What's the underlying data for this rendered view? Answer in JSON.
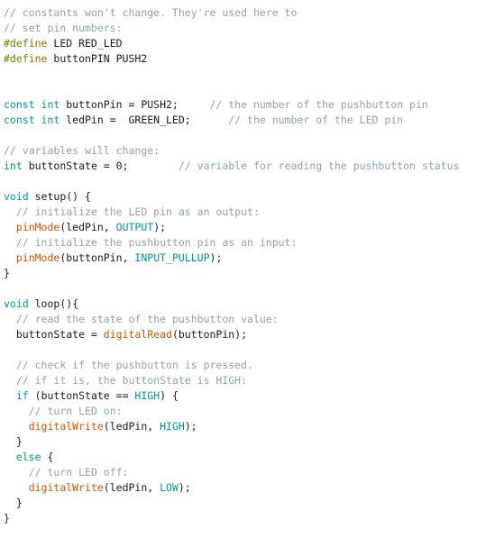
{
  "editor": {
    "language": "arduino-c",
    "background_color": "#ffffff",
    "colors": {
      "plain": "#1a1a1a",
      "comment": "#95a0ac",
      "preprocessor": "#7f7c00",
      "keyword": "#00979c",
      "constant": "#00979c",
      "function": "#d35400"
    },
    "lines": [
      {
        "id": "l1",
        "tokens": [
          {
            "t": "comment",
            "s": "// constants won't change. They're used here to"
          }
        ]
      },
      {
        "id": "l2",
        "tokens": [
          {
            "t": "comment",
            "s": "// set pin numbers:"
          }
        ]
      },
      {
        "id": "l3",
        "tokens": [
          {
            "t": "pre",
            "s": "#define"
          },
          {
            "t": "plain",
            "s": " LED RED_LED"
          }
        ]
      },
      {
        "id": "l4",
        "tokens": [
          {
            "t": "pre",
            "s": "#define"
          },
          {
            "t": "plain",
            "s": " buttonPIN PUSH2"
          }
        ]
      },
      {
        "id": "l5",
        "tokens": [
          {
            "t": "blank",
            "s": " "
          }
        ]
      },
      {
        "id": "l6",
        "tokens": [
          {
            "t": "blank",
            "s": " "
          }
        ]
      },
      {
        "id": "l7",
        "tokens": [
          {
            "t": "kw",
            "s": "const int"
          },
          {
            "t": "plain",
            "s": " buttonPin = PUSH2;     "
          },
          {
            "t": "comment",
            "s": "// the number of the pushbutton pin"
          }
        ]
      },
      {
        "id": "l8",
        "tokens": [
          {
            "t": "kw",
            "s": "const int"
          },
          {
            "t": "plain",
            "s": " ledPin =  GREEN_LED;      "
          },
          {
            "t": "comment",
            "s": "// the number of the LED pin"
          }
        ]
      },
      {
        "id": "l9",
        "tokens": [
          {
            "t": "blank",
            "s": " "
          }
        ]
      },
      {
        "id": "l10",
        "tokens": [
          {
            "t": "comment",
            "s": "// variables will change:"
          }
        ]
      },
      {
        "id": "l11",
        "tokens": [
          {
            "t": "kw",
            "s": "int"
          },
          {
            "t": "plain",
            "s": " buttonState = 0;        "
          },
          {
            "t": "comment",
            "s": "// variable for reading the pushbutton status"
          }
        ]
      },
      {
        "id": "l12",
        "tokens": [
          {
            "t": "blank",
            "s": " "
          }
        ]
      },
      {
        "id": "l13",
        "tokens": [
          {
            "t": "kw",
            "s": "void"
          },
          {
            "t": "plain",
            "s": " setup() {"
          }
        ]
      },
      {
        "id": "l14",
        "tokens": [
          {
            "t": "plain",
            "s": "  "
          },
          {
            "t": "comment",
            "s": "// initialize the LED pin as an output:"
          }
        ]
      },
      {
        "id": "l15",
        "tokens": [
          {
            "t": "plain",
            "s": "  "
          },
          {
            "t": "fn",
            "s": "pinMode"
          },
          {
            "t": "plain",
            "s": "(ledPin, "
          },
          {
            "t": "const",
            "s": "OUTPUT"
          },
          {
            "t": "plain",
            "s": ");"
          }
        ]
      },
      {
        "id": "l16",
        "tokens": [
          {
            "t": "plain",
            "s": "  "
          },
          {
            "t": "comment",
            "s": "// initialize the pushbutton pin as an input:"
          }
        ]
      },
      {
        "id": "l17",
        "tokens": [
          {
            "t": "plain",
            "s": "  "
          },
          {
            "t": "fn",
            "s": "pinMode"
          },
          {
            "t": "plain",
            "s": "(buttonPin, "
          },
          {
            "t": "const",
            "s": "INPUT_PULLUP"
          },
          {
            "t": "plain",
            "s": ");"
          }
        ]
      },
      {
        "id": "l18",
        "tokens": [
          {
            "t": "plain",
            "s": "}"
          }
        ]
      },
      {
        "id": "l19",
        "tokens": [
          {
            "t": "blank",
            "s": " "
          }
        ]
      },
      {
        "id": "l20",
        "tokens": [
          {
            "t": "kw",
            "s": "void"
          },
          {
            "t": "plain",
            "s": " loop(){"
          }
        ]
      },
      {
        "id": "l21",
        "tokens": [
          {
            "t": "plain",
            "s": "  "
          },
          {
            "t": "comment",
            "s": "// read the state of the pushbutton value:"
          }
        ]
      },
      {
        "id": "l22",
        "tokens": [
          {
            "t": "plain",
            "s": "  buttonState = "
          },
          {
            "t": "fn",
            "s": "digitalRead"
          },
          {
            "t": "plain",
            "s": "(buttonPin);"
          }
        ]
      },
      {
        "id": "l23",
        "tokens": [
          {
            "t": "blank",
            "s": " "
          }
        ]
      },
      {
        "id": "l24",
        "tokens": [
          {
            "t": "plain",
            "s": "  "
          },
          {
            "t": "comment",
            "s": "// check if the pushbutton is pressed."
          }
        ]
      },
      {
        "id": "l25",
        "tokens": [
          {
            "t": "plain",
            "s": "  "
          },
          {
            "t": "comment",
            "s": "// if it is, the buttonState is HIGH:"
          }
        ]
      },
      {
        "id": "l26",
        "tokens": [
          {
            "t": "plain",
            "s": "  "
          },
          {
            "t": "kw",
            "s": "if"
          },
          {
            "t": "plain",
            "s": " (buttonState == "
          },
          {
            "t": "const",
            "s": "HIGH"
          },
          {
            "t": "plain",
            "s": ") {"
          }
        ]
      },
      {
        "id": "l27",
        "tokens": [
          {
            "t": "plain",
            "s": "    "
          },
          {
            "t": "comment",
            "s": "// turn LED on:"
          }
        ]
      },
      {
        "id": "l28",
        "tokens": [
          {
            "t": "plain",
            "s": "    "
          },
          {
            "t": "fn",
            "s": "digitalWrite"
          },
          {
            "t": "plain",
            "s": "(ledPin, "
          },
          {
            "t": "const",
            "s": "HIGH"
          },
          {
            "t": "plain",
            "s": ");"
          }
        ]
      },
      {
        "id": "l29",
        "tokens": [
          {
            "t": "plain",
            "s": "  }"
          }
        ]
      },
      {
        "id": "l30",
        "tokens": [
          {
            "t": "kw",
            "s": "  else"
          },
          {
            "t": "plain",
            "s": " {"
          }
        ]
      },
      {
        "id": "l31",
        "tokens": [
          {
            "t": "plain",
            "s": "    "
          },
          {
            "t": "comment",
            "s": "// turn LED off:"
          }
        ]
      },
      {
        "id": "l32",
        "tokens": [
          {
            "t": "plain",
            "s": "    "
          },
          {
            "t": "fn",
            "s": "digitalWrite"
          },
          {
            "t": "plain",
            "s": "(ledPin, "
          },
          {
            "t": "const",
            "s": "LOW"
          },
          {
            "t": "plain",
            "s": ");"
          }
        ]
      },
      {
        "id": "l33",
        "tokens": [
          {
            "t": "plain",
            "s": "  }"
          }
        ]
      },
      {
        "id": "l34",
        "tokens": [
          {
            "t": "plain",
            "s": "}"
          }
        ]
      }
    ]
  }
}
